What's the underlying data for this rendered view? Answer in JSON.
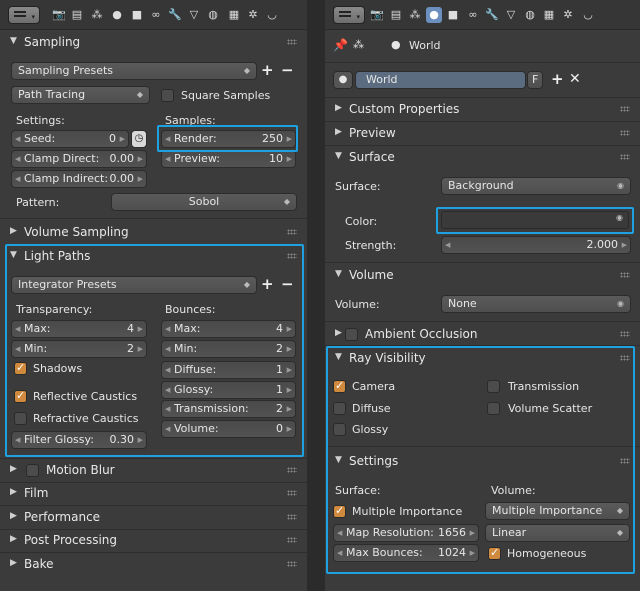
{
  "left": {
    "sampling": {
      "title": "Sampling",
      "presets": "Sampling Presets",
      "integrator": "Path Tracing",
      "square_samples": "Square Samples",
      "settings_label": "Settings:",
      "samples_label": "Samples:",
      "seed": {
        "label": "Seed:",
        "value": "0"
      },
      "clamp_direct": {
        "label": "Clamp Direct:",
        "value": "0.00"
      },
      "clamp_indirect": {
        "label": "Clamp Indirect:",
        "value": "0.00"
      },
      "render": {
        "label": "Render:",
        "value": "250"
      },
      "preview": {
        "label": "Preview:",
        "value": "10"
      },
      "pattern_label": "Pattern:",
      "pattern_value": "Sobol"
    },
    "volume_sampling": "Volume Sampling",
    "light_paths": {
      "title": "Light Paths",
      "presets": "Integrator Presets",
      "transparency_label": "Transparency:",
      "bounces_label": "Bounces:",
      "t_max": {
        "label": "Max:",
        "value": "4"
      },
      "t_min": {
        "label": "Min:",
        "value": "2"
      },
      "shadows": "Shadows",
      "reflective": "Reflective Caustics",
      "refractive": "Refractive Caustics",
      "filter_glossy": {
        "label": "Filter Glossy:",
        "value": "0.30"
      },
      "b_max": {
        "label": "Max:",
        "value": "4"
      },
      "b_min": {
        "label": "Min:",
        "value": "2"
      },
      "diffuse": {
        "label": "Diffuse:",
        "value": "1"
      },
      "glossy": {
        "label": "Glossy:",
        "value": "1"
      },
      "transmission": {
        "label": "Transmission:",
        "value": "2"
      },
      "volume": {
        "label": "Volume:",
        "value": "0"
      }
    },
    "motion_blur": "Motion Blur",
    "film": "Film",
    "performance": "Performance",
    "post_processing": "Post Processing",
    "bake": "Bake"
  },
  "right": {
    "world_label": "World",
    "world_name": "World",
    "fake_user": "F",
    "custom_properties": "Custom Properties",
    "preview": "Preview",
    "surface": {
      "title": "Surface",
      "surface_label": "Surface:",
      "surface_value": "Background",
      "color_label": "Color:",
      "strength": {
        "label": "Strength:",
        "value": "2.000"
      }
    },
    "volume": {
      "title": "Volume",
      "label": "Volume:",
      "value": "None"
    },
    "ambient_occlusion": "Ambient Occlusion",
    "ray_visibility": {
      "title": "Ray Visibility",
      "camera": "Camera",
      "diffuse": "Diffuse",
      "glossy": "Glossy",
      "transmission": "Transmission",
      "volume_scatter": "Volume Scatter"
    },
    "settings": {
      "title": "Settings",
      "surface_label": "Surface:",
      "volume_label": "Volume:",
      "multiple_importance": "Multiple Importance",
      "map_resolution": {
        "label": "Map Resolution:",
        "value": "1656"
      },
      "max_bounces": {
        "label": "Max Bounces:",
        "value": "1024"
      },
      "vol_sampling": "Multiple Importance",
      "interpolation": "Linear",
      "homogeneous": "Homogeneous"
    }
  },
  "colors": {
    "highlight": "#1da1e0",
    "checkbox_on": "#d08a3e",
    "active_tab": "#6b8fbf"
  }
}
